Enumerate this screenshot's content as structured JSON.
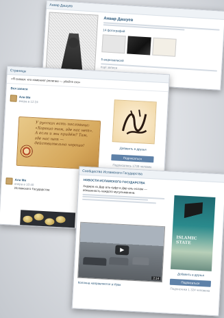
{
  "back_screenshot": {
    "page_title": "Анвар Дашуев",
    "profile_name": "Анвар Дашуев",
    "photos_label": "14 фотографий",
    "videos_label": "5 видеозаписей",
    "friends_label": "ещё записи"
  },
  "middle_screenshot": {
    "header_title": "Страницы",
    "status_text": "«Я сказал: кто изменяет религию — убейте его»",
    "wall_label": "Вся записи",
    "post1": {
      "author": "Али Ми",
      "time": "вчера в 12:24",
      "parchment_text": "У русских есть пословица: «Хорошо там, где нас нет». А если и мы придём? Там, где нас нет — действительно хорошо!"
    },
    "calligraphy_caption": "Добавить в друзья",
    "subscribe_label": "Подписаться",
    "followers_text": "Подписались 1739 человек",
    "post2": {
      "author": "Али Ми",
      "time": "вчера в 10:40",
      "text": "Исламского Государства"
    }
  },
  "front_screenshot": {
    "header_title": "Сообщество Исламского Государства",
    "sub_title": "НОВОСТИ ИСЛАМСКОГО ГОСУДАРСТВА",
    "body_text": "Хиджра из Дар аль-куфр в Дар аль-ислам — обязанность каждого мусульманина.",
    "video_caption": "Колонна направляется в Ирак",
    "video_duration": "2:14",
    "poster_text": "ISLAMIC STATE",
    "add_friend_label": "Добавить в друзья",
    "subscribe_label": "Подписаться",
    "followers_text": "Подписчики 1 324 человека"
  }
}
